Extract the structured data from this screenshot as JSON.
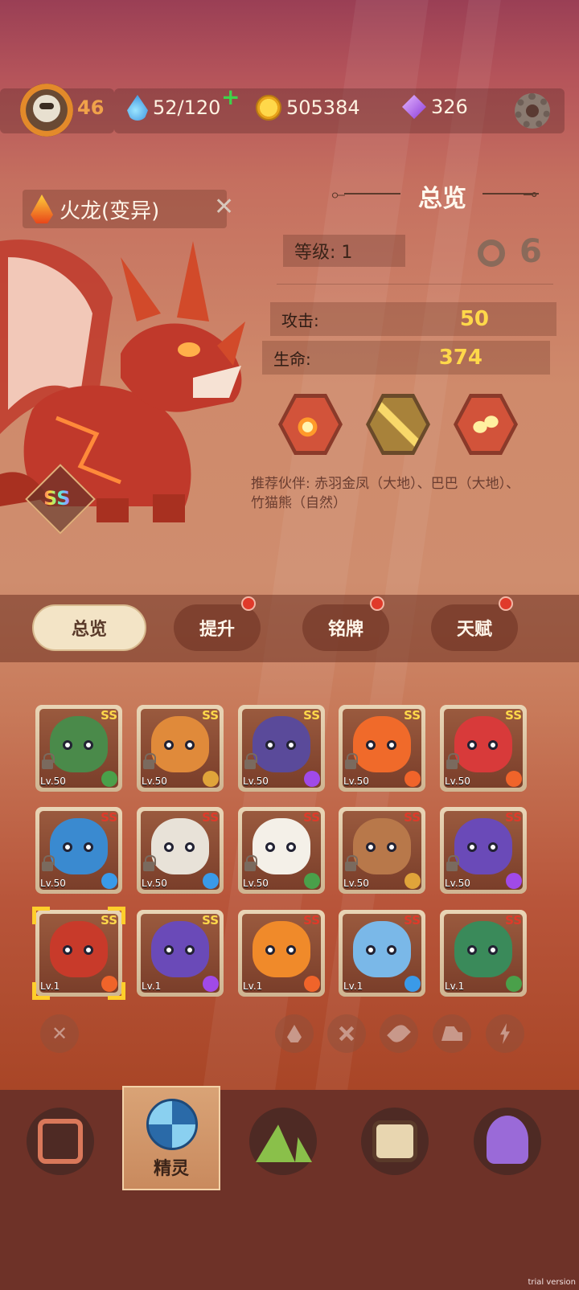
{
  "topbar": {
    "player_level": "46",
    "energy": "52/120",
    "energy_plus": "+",
    "coins": "505384",
    "gems": "326"
  },
  "pet": {
    "name": "火龙(变异)",
    "rank": "SS",
    "close": "✕"
  },
  "overview": {
    "title": "总览",
    "ornament_left": "⟜ ",
    "ornament_right": " ⊸",
    "level_label": "等级: 1",
    "attack_label": "攻击:",
    "attack_value": "50",
    "hp_label": "生命:",
    "hp_value": "374",
    "recommend": "推荐伙伴: 赤羽金凤（大地）、巴巴（大地）、竹猫熊（自然）",
    "colors": {
      "value": "#ffd84a",
      "skill_border": "#8a3a2a"
    }
  },
  "tabs": [
    {
      "label": "总览",
      "active": true
    },
    {
      "label": "提升",
      "badge": true
    },
    {
      "label": "铭牌",
      "badge": true
    },
    {
      "label": "天赋",
      "badge": true
    }
  ],
  "pets": [
    {
      "rank": "SS",
      "level": "Lv.50",
      "element": "nature-icon",
      "color": "#4a8a4a",
      "rank_color": "#ffd84a"
    },
    {
      "rank": "SS",
      "level": "Lv.50",
      "element": "earth-icon",
      "color": "#e08a3a",
      "rank_color": "#ffd84a"
    },
    {
      "rank": "SS",
      "level": "Lv.50",
      "element": "thunder-icon",
      "color": "#5a4a9a",
      "rank_color": "#ffd84a"
    },
    {
      "rank": "SS",
      "level": "Lv.50",
      "element": "fire-icon",
      "color": "#f06a2a",
      "rank_color": "#ffd84a"
    },
    {
      "rank": "SS",
      "level": "Lv.50",
      "element": "fire-icon",
      "color": "#d83a3a",
      "rank_color": "#ffd84a"
    },
    {
      "rank": "SS",
      "level": "Lv.50",
      "element": "ice-icon",
      "color": "#3a8ad0",
      "rank_color": "#e03a2a"
    },
    {
      "rank": "SS",
      "level": "Lv.50",
      "element": "ice-icon",
      "color": "#e8e2d8",
      "rank_color": "#e03a2a"
    },
    {
      "rank": "SS",
      "level": "Lv.50",
      "element": "nature-icon",
      "color": "#f4f0e8",
      "rank_color": "#e03a2a"
    },
    {
      "rank": "SS",
      "level": "Lv.50",
      "element": "earth-icon",
      "color": "#b8784a",
      "rank_color": "#e03a2a"
    },
    {
      "rank": "SS",
      "level": "Lv.50",
      "element": "thunder-icon",
      "color": "#6a4ab8",
      "rank_color": "#e03a2a"
    },
    {
      "rank": "SS",
      "level": "Lv.1",
      "element": "fire-icon",
      "color": "#c83a2a",
      "rank_color": "#ffd84a",
      "selected": true
    },
    {
      "rank": "SS",
      "level": "Lv.1",
      "element": "thunder-icon",
      "color": "#6a4ab8",
      "rank_color": "#ffd84a"
    },
    {
      "rank": "SS",
      "level": "Lv.1",
      "element": "fire-icon",
      "color": "#f08a2a",
      "rank_color": "#e03a2a"
    },
    {
      "rank": "SS",
      "level": "Lv.1",
      "element": "ice-icon",
      "color": "#7ab8e8",
      "rank_color": "#e03a2a"
    },
    {
      "rank": "SS",
      "level": "Lv.1",
      "element": "nature-icon",
      "color": "#3a8a5a",
      "rank_color": "#e03a2a"
    }
  ],
  "filters": {
    "clear": "✕"
  },
  "nav": {
    "active_label": "精灵"
  },
  "watermark": "trial version"
}
